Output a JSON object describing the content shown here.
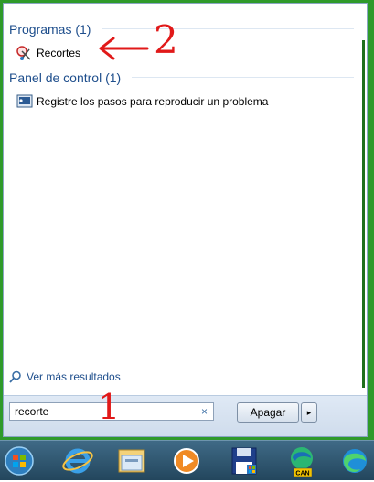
{
  "start_menu": {
    "sections": [
      {
        "title": "Programas (1)",
        "items": [
          {
            "label": "Recortes",
            "icon": "snipping-tool-icon"
          }
        ]
      },
      {
        "title": "Panel de control (1)",
        "items": [
          {
            "label": "Registre los pasos para reproducir un problema",
            "icon": "steps-recorder-icon"
          }
        ]
      }
    ],
    "see_more": "Ver más resultados",
    "search": {
      "value": "recorte"
    },
    "shutdown_label": "Apagar",
    "shutdown_arrow": "▸",
    "clear_glyph": "×"
  },
  "annotations": {
    "one": "1",
    "two": "2"
  },
  "taskbar": {
    "items": [
      "start-orb-icon",
      "internet-explorer-icon",
      "file-explorer-icon",
      "media-player-icon",
      "floppy-save-icon",
      "edge-canary-icon",
      "edge-icon"
    ],
    "edge_canary_badge": "CAN"
  },
  "colors": {
    "frame": "#2f9a2a",
    "section_title": "#1e4e8c",
    "annotation": "#e11919"
  }
}
